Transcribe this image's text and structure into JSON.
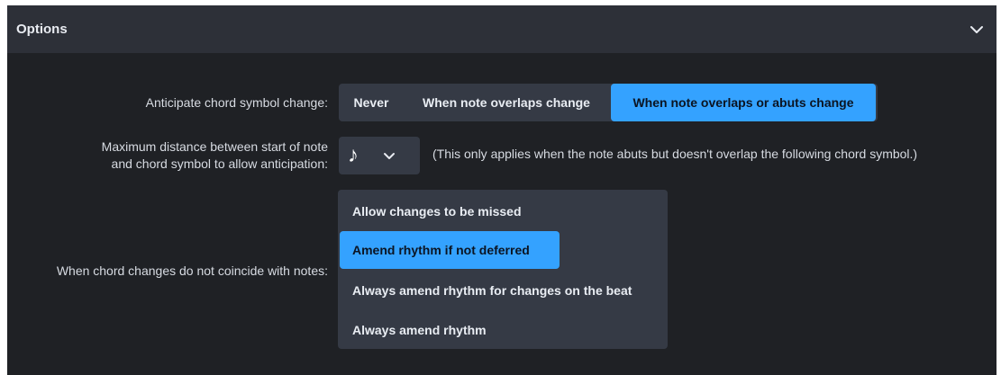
{
  "header": {
    "title": "Options",
    "collapse_icon": "chevron-down-icon"
  },
  "anticipate": {
    "label": "Anticipate chord symbol change:",
    "options": [
      "Never",
      "When note overlaps change",
      "When note overlaps or abuts change"
    ],
    "selected": "When note overlaps or abuts change"
  },
  "max_distance": {
    "label_line1": "Maximum distance between start of note",
    "label_line2": "and chord symbol to allow anticipation:",
    "value_glyph": "♪",
    "value_icon": "eighth-note-icon",
    "hint": "(This only applies when the note abuts but doesn't overlap the following chord symbol.)"
  },
  "coincide": {
    "label": "When chord changes do not coincide with notes:",
    "options": [
      "Allow changes to be missed",
      "Amend rhythm if not deferred",
      "Always amend rhythm for changes on the beat",
      "Always amend rhythm"
    ],
    "selected": "Amend rhythm if not deferred"
  },
  "colors": {
    "accent": "#34a2ff",
    "panel": "#1f2125",
    "header": "#2d3038",
    "control": "#353a45"
  }
}
